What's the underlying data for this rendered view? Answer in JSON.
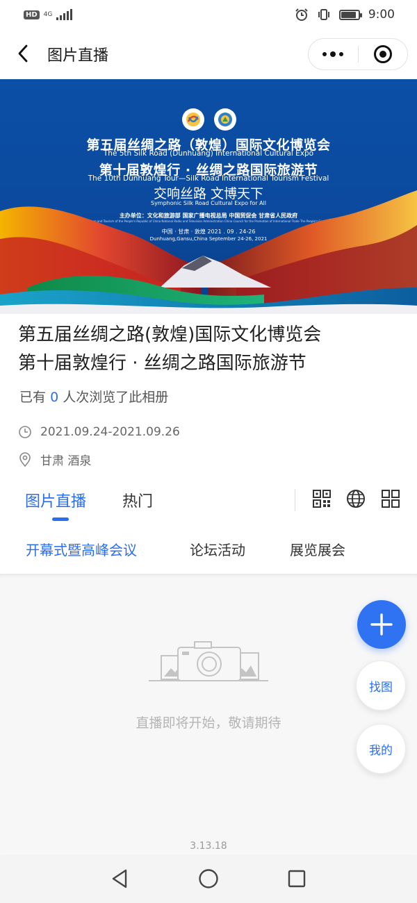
{
  "status_bar": {
    "hd": "HD",
    "network": "4G",
    "time": "9:00",
    "battery_level": 0.9
  },
  "nav": {
    "title": "图片直播"
  },
  "banner": {
    "line1": "第五届丝绸之路（敦煌）国际文化博览会",
    "line1_en": "The 5th Silk Road (Dunhuang) International Cultural Expo",
    "line2": "第十届敦煌行 · 丝绸之路国际旅游节",
    "line2_en": "The 10th Dunhuang Tour—Silk Road International Tourism Festival",
    "slogan": "交响丝路  文博天下",
    "slogan_en": "Symphonic Silk Road      Cultural Expo for All",
    "hosts": "主办单位：文化和旅游部    国家广播电视总局    中国贸促会    甘肃省人民政府",
    "hosts_en": "Hosted by: Ministry of Culture and Tourism of the People's Republic of China    National Radio and Television Administration    China Council for the Promotion of International Trade    The People's Government of Gansu Province",
    "date": "中国 · 甘肃 · 敦煌        2021 . 09 . 24-26",
    "date_en": "Dunhuang,Gansu,China  September 24-26, 2021"
  },
  "album": {
    "title_line1": "第五届丝绸之路(敦煌)国际文化博览会",
    "title_line2": "第十届敦煌行 · 丝绸之路国际旅游节",
    "views_prefix": "已有",
    "views_count": "0",
    "views_suffix": "人次浏览了此相册",
    "date_range": "2021.09.24-2021.09.26",
    "location": "甘肃 酒泉"
  },
  "tabs": [
    {
      "label": "图片直播",
      "active": true
    },
    {
      "label": "热门",
      "active": false
    }
  ],
  "subcategories": [
    {
      "label": "开幕式暨高峰会议",
      "active": true
    },
    {
      "label": "论坛活动",
      "active": false
    },
    {
      "label": "展览展会",
      "active": false
    }
  ],
  "empty_state": {
    "message": "直播即将开始，敬请期待"
  },
  "floating": {
    "find": "找图",
    "mine": "我的"
  },
  "version": "3.13.18",
  "colors": {
    "accent": "#2a6ef0",
    "banner_blue": "#0b4fa6",
    "fab": "#2f73f2"
  },
  "icons": {
    "back": "chevron-left-icon",
    "more": "more-dots-icon",
    "close": "target-close-icon",
    "clock": "clock-icon",
    "location": "location-pin-icon",
    "qr": "qr-code-icon",
    "globe": "globe-icon",
    "grid": "grid-layout-icon",
    "add": "plus-icon"
  }
}
